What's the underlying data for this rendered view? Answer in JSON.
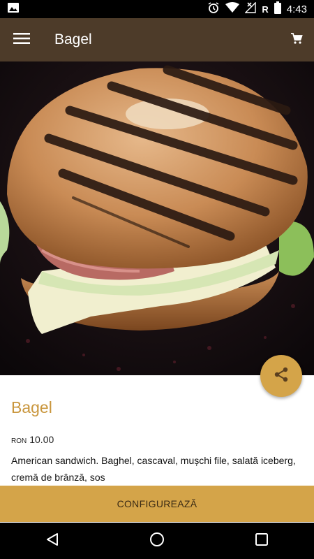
{
  "status_bar": {
    "time": "4:43",
    "network_label": "R",
    "icons": [
      "image-icon",
      "alarm-icon",
      "wifi-icon",
      "signal-icon",
      "battery-icon"
    ]
  },
  "app_bar": {
    "title": "Bagel",
    "menu_icon": "hamburger-menu-icon",
    "cart_icon": "shopping-cart-icon"
  },
  "hero": {
    "image": "grilled-bagel-sandwich-photo"
  },
  "product": {
    "title": "Bagel",
    "currency": "RON",
    "price": "10.00",
    "description": "American sandwich. Baghel, cascaval, mușchi file, salată iceberg, cremă de brânză, sos"
  },
  "actions": {
    "share_icon": "share-icon",
    "configure_label": "CONFIGUREAZĂ"
  },
  "nav_bar": {
    "icons": [
      "back-icon",
      "home-icon",
      "recents-icon"
    ]
  },
  "colors": {
    "app_bar": "#4d3b29",
    "accent": "#d4a449",
    "title": "#c9963d"
  }
}
